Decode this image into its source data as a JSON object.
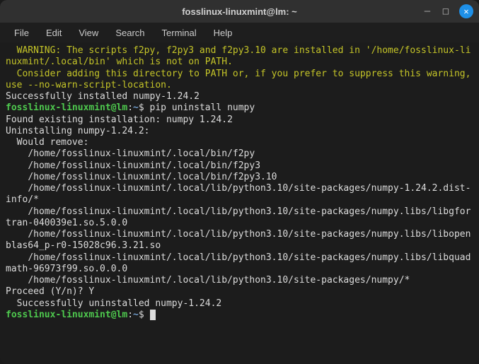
{
  "window": {
    "title": "fosslinux-linuxmint@lm: ~"
  },
  "menu": {
    "file": "File",
    "edit": "Edit",
    "view": "View",
    "search": "Search",
    "terminal": "Terminal",
    "help": "Help"
  },
  "prompt": {
    "user_host": "fosslinux-linuxmint@lm",
    "colon": ":",
    "path": "~",
    "symbol": "$"
  },
  "output": {
    "warn1": "  WARNING: The scripts f2py, f2py3 and f2py3.10 are installed in '/home/fosslinux-linuxmint/.local/bin' which is not on PATH.",
    "warn2": "  Consider adding this directory to PATH or, if you prefer to suppress this warning, use --no-warn-script-location.",
    "installed": "Successfully installed numpy-1.24.2",
    "cmd1": " pip uninstall numpy",
    "found": "Found existing installation: numpy 1.24.2",
    "uninstalling": "Uninstalling numpy-1.24.2:",
    "would_remove": "  Would remove:",
    "path1": "    /home/fosslinux-linuxmint/.local/bin/f2py",
    "path2": "    /home/fosslinux-linuxmint/.local/bin/f2py3",
    "path3": "    /home/fosslinux-linuxmint/.local/bin/f2py3.10",
    "path4": "    /home/fosslinux-linuxmint/.local/lib/python3.10/site-packages/numpy-1.24.2.dist-info/*",
    "path5": "    /home/fosslinux-linuxmint/.local/lib/python3.10/site-packages/numpy.libs/libgfortran-040039e1.so.5.0.0",
    "path6": "    /home/fosslinux-linuxmint/.local/lib/python3.10/site-packages/numpy.libs/libopenblas64_p-r0-15028c96.3.21.so",
    "path7": "    /home/fosslinux-linuxmint/.local/lib/python3.10/site-packages/numpy.libs/libquadmath-96973f99.so.0.0.0",
    "path8": "    /home/fosslinux-linuxmint/.local/lib/python3.10/site-packages/numpy/*",
    "proceed": "Proceed (Y/n)? Y",
    "success": "  Successfully uninstalled numpy-1.24.2",
    "cmd2": " "
  }
}
